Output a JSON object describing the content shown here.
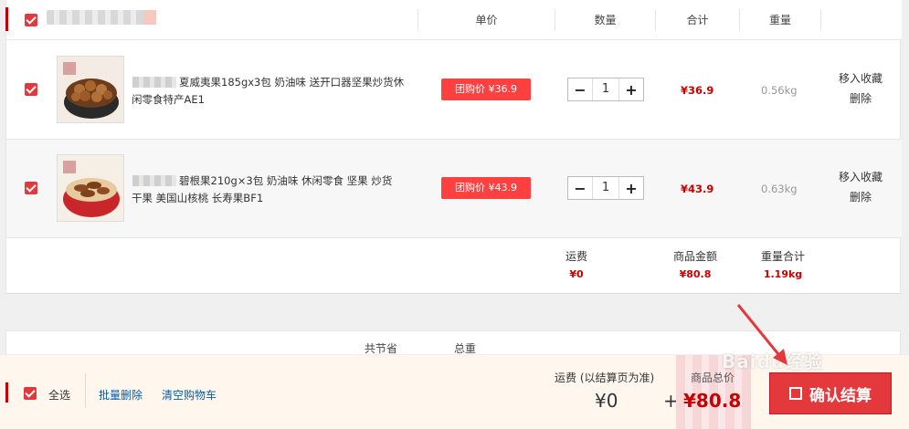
{
  "header": {
    "col_price": "单价",
    "col_qty": "数量",
    "col_total": "合计",
    "col_weight": "重量"
  },
  "items": [
    {
      "title": "夏威夷果185gx3包 奶油味 送开口器坚果炒货休闲零食特产AE1",
      "price_badge": "团购价 ¥36.9",
      "qty": "1",
      "total": "¥36.9",
      "weight": "0.56kg",
      "action_fav": "移入收藏",
      "action_delete": "删除"
    },
    {
      "title": "碧根果210g×3包 奶油味 休闲零食 坚果 炒货 干果 美国山核桃 长寿果BF1",
      "price_badge": "团购价 ¥43.9",
      "qty": "1",
      "total": "¥43.9",
      "weight": "0.63kg",
      "action_fav": "移入收藏",
      "action_delete": "删除"
    }
  ],
  "summary": {
    "shipping_label": "运费",
    "shipping_value": "¥0",
    "goods_label": "商品金额",
    "goods_value": "¥80.8",
    "weight_label": "重量合计",
    "weight_value": "1.19kg"
  },
  "strip": {
    "saved_label": "共节省",
    "total_weight_label": "总重"
  },
  "footer": {
    "select_all": "全选",
    "batch_delete": "批量删除",
    "clear_cart": "清空购物车",
    "shipping_label": "运费 (以结算页为准)",
    "shipping_value": "¥0",
    "plus": "+",
    "goods_label": "商品总价",
    "goods_value": "¥80.8",
    "checkout": "确认结算"
  },
  "watermark": "Baidu经验",
  "colors": {
    "accent_red": "#e4393c",
    "price_red": "#c80000",
    "link_blue": "#005ea7"
  }
}
